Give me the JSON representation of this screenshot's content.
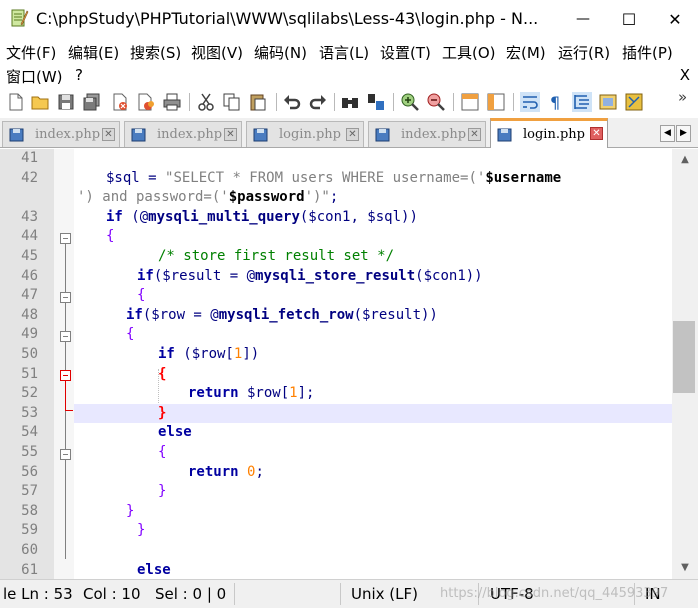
{
  "window": {
    "title": "C:\\phpStudy\\PHPTutorial\\WWW\\sqlilabs\\Less-43\\login.php - N...",
    "minimize_glyph": "—",
    "maximize_glyph": "☐",
    "close_glyph": "✕"
  },
  "menu": {
    "items": [
      "文件(F)",
      "编辑(E)",
      "搜索(S)",
      "视图(V)",
      "编码(N)",
      "语言(L)",
      "设置(T)",
      "工具(O)",
      "宏(M)",
      "运行(R)",
      "插件(P)"
    ],
    "row2": [
      "窗口(W)",
      "?"
    ],
    "close_doc": "X"
  },
  "toolbar": {
    "icons": [
      "new-file-icon",
      "open-file-icon",
      "save-icon",
      "save-all-icon",
      "close-icon",
      "close-all-icon",
      "print-icon",
      "cut-icon",
      "copy-icon",
      "paste-icon",
      "undo-icon",
      "redo-icon",
      "find-icon",
      "replace-icon",
      "zoom-in-icon",
      "zoom-out-icon",
      "sync-v-icon",
      "sync-h-icon",
      "wrap-icon",
      "show-all-chars-icon",
      "indent-guide-icon",
      "doc-map-icon",
      "function-list-icon"
    ],
    "overflow": "»"
  },
  "tabs": [
    {
      "label": "index.php",
      "active": false
    },
    {
      "label": "index.php",
      "active": false
    },
    {
      "label": "login.php",
      "active": false
    },
    {
      "label": "index.php",
      "active": false
    },
    {
      "label": "login.php",
      "active": true
    }
  ],
  "tab_nav": {
    "left": "◀",
    "right": "▶"
  },
  "editor": {
    "lines": [
      {
        "n": "41"
      },
      {
        "n": "42"
      },
      {
        "n": ""
      },
      {
        "n": "43"
      },
      {
        "n": "44"
      },
      {
        "n": "45"
      },
      {
        "n": "46"
      },
      {
        "n": "47"
      },
      {
        "n": "48"
      },
      {
        "n": "49"
      },
      {
        "n": "50"
      },
      {
        "n": "51"
      },
      {
        "n": "52"
      },
      {
        "n": "53"
      },
      {
        "n": "54"
      },
      {
        "n": "55"
      },
      {
        "n": "56"
      },
      {
        "n": "57"
      },
      {
        "n": "58"
      },
      {
        "n": "59"
      },
      {
        "n": "60"
      },
      {
        "n": "61"
      }
    ],
    "code": {
      "l42a_var": "$sql",
      "l42a_op": " = ",
      "l42a_str": "\"SELECT * FROM users WHERE username=('",
      "l42a_svar": "$username",
      "l42b_str1": "') and password=('",
      "l42b_svar": "$password",
      "l42b_str2": "')\"",
      "l42b_end": ";",
      "l43_kw": "if",
      "l43_p1": " (",
      "l43_at": "@",
      "l43_fn": "mysqli_multi_query",
      "l43_args": "($con1, $sql))",
      "l44": "{",
      "l45": "/* store first result set */",
      "l46_kw": "if",
      "l46_a": "($result = @",
      "l46_fn": "mysqli_store_result",
      "l46_b": "($con1))",
      "l47": "{",
      "l48_kw": "if",
      "l48_a": "($row = @",
      "l48_fn": "mysqli_fetch_row",
      "l48_b": "($result))",
      "l49": "{",
      "l50_kw": "if",
      "l50_a": " ($row[",
      "l50_num": "1",
      "l50_b": "])",
      "l51": "{",
      "l52_kw": "return",
      "l52_a": " $row[",
      "l52_num": "1",
      "l52_b": "];",
      "l53": "}",
      "l54": "else",
      "l55": "{",
      "l56_kw": "return",
      "l56_num": "0",
      "l56_end": ";",
      "l57": "}",
      "l58": "}",
      "l59": "}",
      "l61": "else"
    }
  },
  "scrollbar": {
    "up": "▲",
    "down": "▼"
  },
  "status": {
    "ln": "le Ln : 53",
    "col": "Col : 10",
    "sel": "Sel : 0 | 0",
    "eol": "Unix (LF)",
    "encoding": "UTF-8",
    "ins": "IN",
    "watermark": "https://blog.csdn.net/qq_44593397"
  },
  "colors": {
    "keyword": "#0000a0",
    "comment": "#008000",
    "number": "#ff8000",
    "brace": "#8000ff",
    "brace_match": "#ff0000",
    "current_line": "#e8e8ff",
    "active_tab_accent": "#f0a040"
  }
}
